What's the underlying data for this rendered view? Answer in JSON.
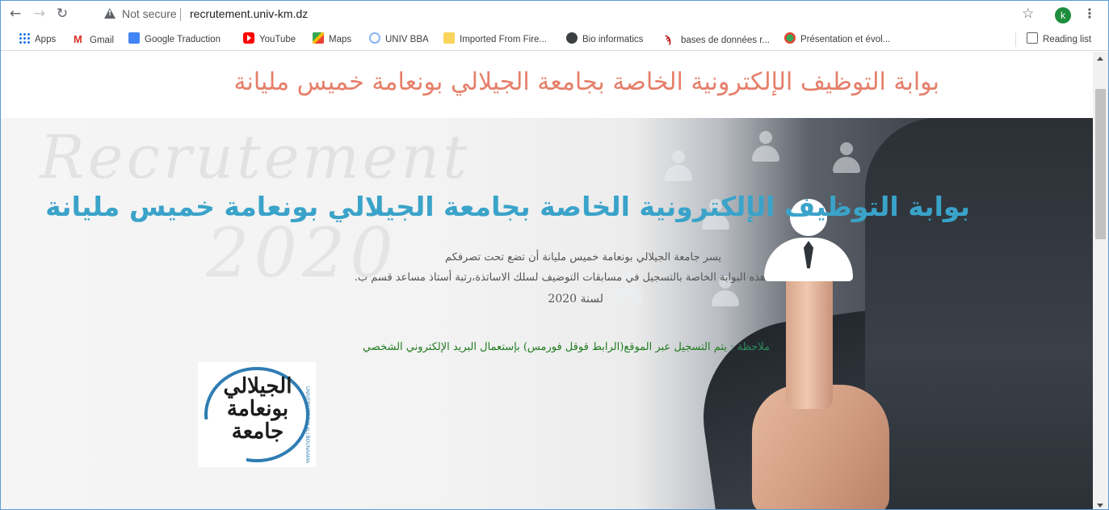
{
  "browser": {
    "not_secure_label": "Not secure",
    "url": "recrutement.univ-km.dz",
    "profile_initial": "k",
    "icons": {
      "back": "back-arrow-icon",
      "forward": "forward-arrow-icon",
      "reload": "reload-icon",
      "star": "star-icon",
      "menu": "kebab-menu-icon"
    }
  },
  "bookmarks": [
    {
      "label": "Apps",
      "icon": "apps-grid-icon"
    },
    {
      "label": "Gmail",
      "icon": "gmail-icon"
    },
    {
      "label": "Google Traduction",
      "icon": "google-translate-icon"
    },
    {
      "label": "YouTube",
      "icon": "youtube-icon"
    },
    {
      "label": "Maps",
      "icon": "maps-icon"
    },
    {
      "label": "UNIV BBA",
      "icon": "univ-icon"
    },
    {
      "label": "Imported From Fire...",
      "icon": "folder-icon"
    },
    {
      "label": "Bio informatics",
      "icon": "bio-icon"
    },
    {
      "label": "bases de données r...",
      "icon": "bookmark-site-icon"
    },
    {
      "label": "Présentation et évol...",
      "icon": "flag-icon"
    }
  ],
  "reading_list": {
    "label": "Reading list",
    "icon": "reading-list-icon"
  },
  "page": {
    "header_title": "بوابة التوظيف الإلكترونية الخاصة بجامعة الجيلالي بونعامة خميس مليانة",
    "hero_title": "بوابة التوظيف الإلكترونية الخاصة بجامعة الجيلالي بونعامة خميس مليانة",
    "intro_line_1": "يسر جامعة الجيلالي بونعامة خميس مليانة أن تضع تحت تصرفكم",
    "intro_line_2": "هذه البوابة الخاصة بالتسجيل في مسابقات التوضيف لسلك الاساتذة،رتبة أستاذ مساعد قسم ب.",
    "intro_line_3": "لسنة 2020",
    "note_label": "ملاحظة :",
    "note_text": "يتم التسجيل عبر الموقع(الرابط قوقل فورمس) بإستعمال البريد الإلكتروني الشخصي",
    "watermark_1": "Recrutement",
    "watermark_2": "2020",
    "logo_text": "الجيلالي بونعامة جامعة",
    "logo_side_text": "UNIVERSITE DJILALI BOUNAAMA"
  },
  "colors": {
    "header_title": "#e57f6a",
    "hero_title": "#3aa3c9",
    "note": "#1f7a1f",
    "avatar": "#1e8e3e"
  }
}
